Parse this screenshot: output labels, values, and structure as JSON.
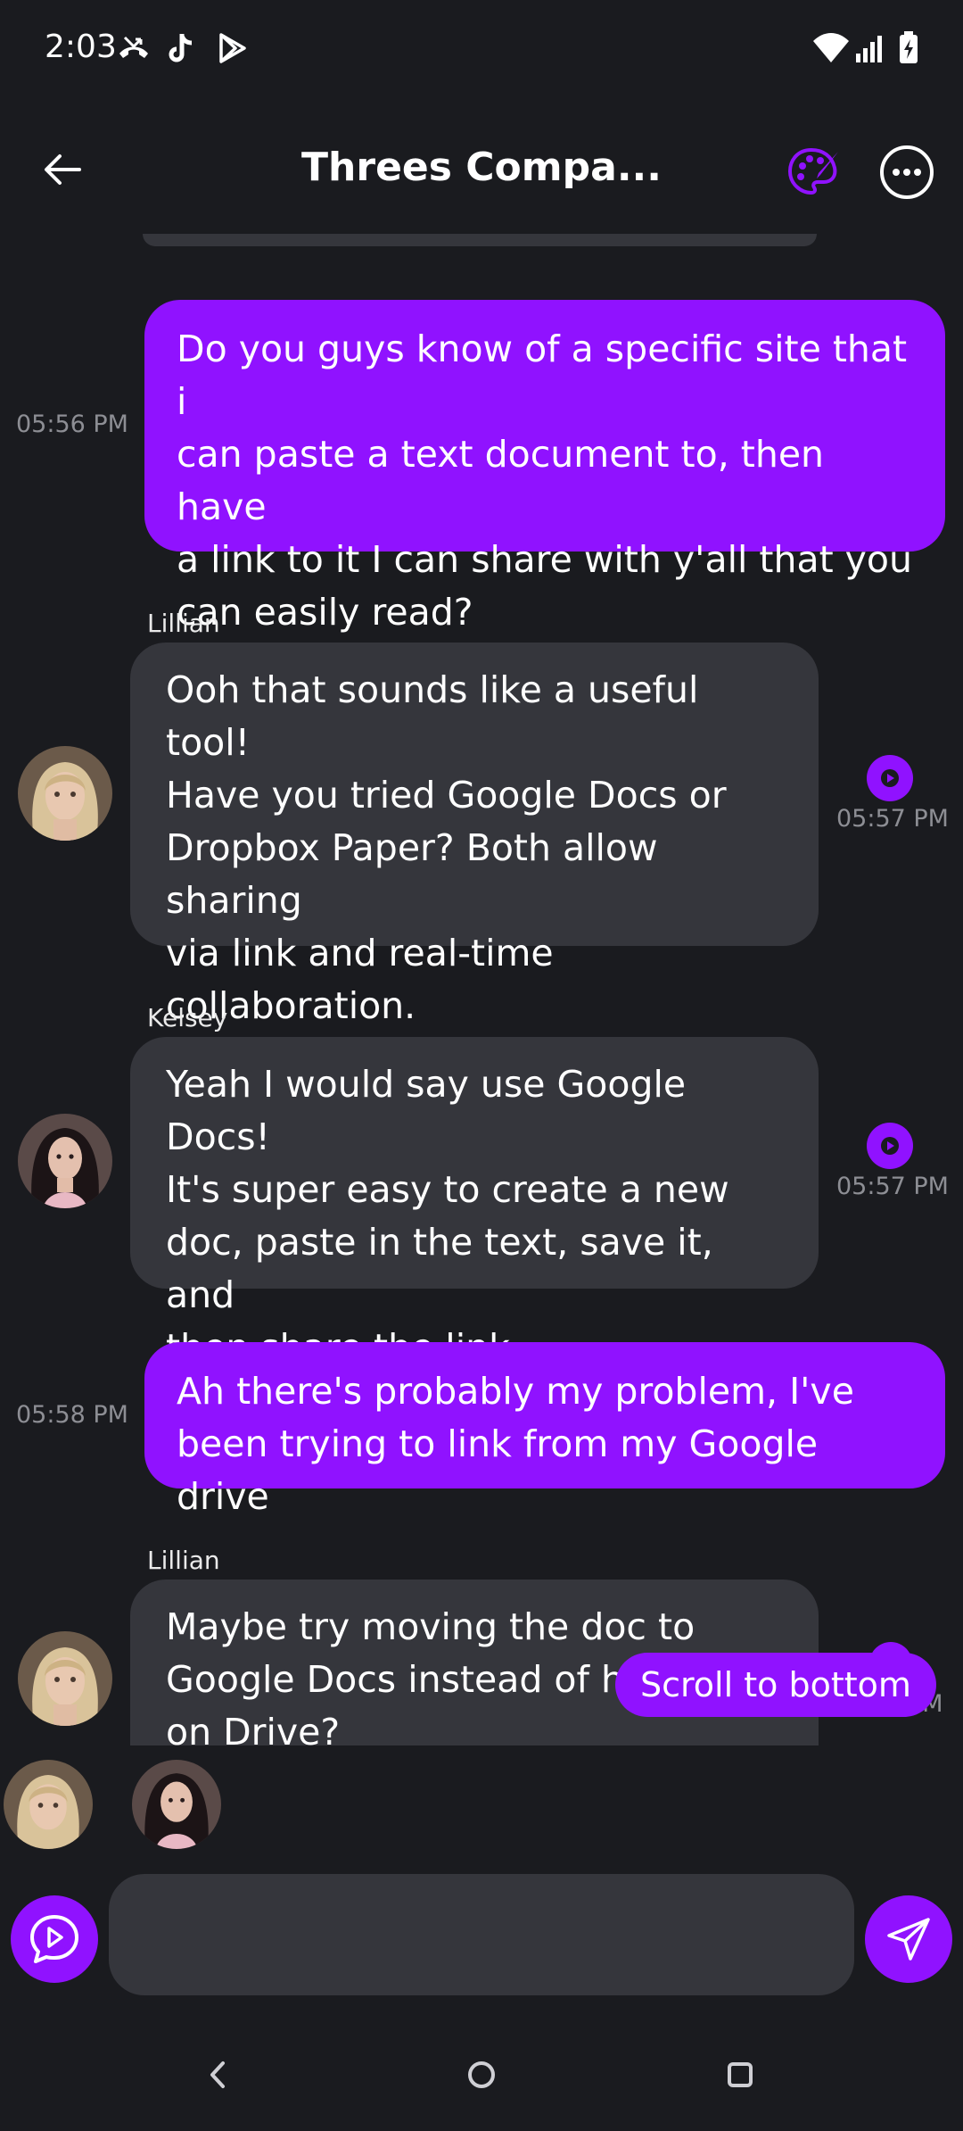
{
  "status_bar": {
    "time": "2:03",
    "icons": [
      "missed-call-icon",
      "tiktok-icon",
      "play-store-icon",
      "wifi-icon",
      "signal-icon",
      "battery-charging-icon"
    ]
  },
  "header": {
    "title": "Threes Compa...",
    "back_icon": "arrow-left-icon",
    "palette_icon": "palette-icon",
    "more_icon": "more-horizontal-icon"
  },
  "colors": {
    "background": "#1a1b1f",
    "accent": "#9012ff",
    "incoming_bubble": "#35363c",
    "muted_text": "#8d8e94"
  },
  "messages": [
    {
      "type": "outgoing",
      "time": "05:56 PM",
      "lines": [
        "Do you guys know of a specific site that i",
        "can paste a text document to, then have",
        "a link to it I can share with y'all that you",
        "can easily read?"
      ]
    },
    {
      "type": "incoming",
      "sender": "Lillian",
      "time": "05:57 PM",
      "lines": [
        "Ooh that sounds like a useful tool!",
        "Have you tried Google Docs or",
        "Dropbox Paper? Both allow sharing",
        "via link and real-time",
        "collaboration."
      ]
    },
    {
      "type": "incoming",
      "sender": "Kelsey",
      "time": "05:57 PM",
      "lines": [
        "Yeah I would say use Google Docs!",
        "It's super easy to create a new",
        "doc, paste in the text, save it, and",
        "then share the link."
      ]
    },
    {
      "type": "outgoing",
      "time": "05:58 PM",
      "lines": [
        "Ah there's probably my problem, I've",
        "been trying to link from my Google drive"
      ]
    },
    {
      "type": "incoming",
      "sender": "Lillian",
      "time_partial": "PM",
      "lines": [
        "Maybe try moving the doc to",
        "Google Docs instead of ho",
        "on Drive?"
      ]
    }
  ],
  "scroll_to_bottom": "Scroll to bottom",
  "composer": {
    "placeholder": "",
    "value": ""
  },
  "nav": {
    "back_icon": "nav-back-icon",
    "home_icon": "nav-home-icon",
    "recents_icon": "nav-recents-icon"
  }
}
